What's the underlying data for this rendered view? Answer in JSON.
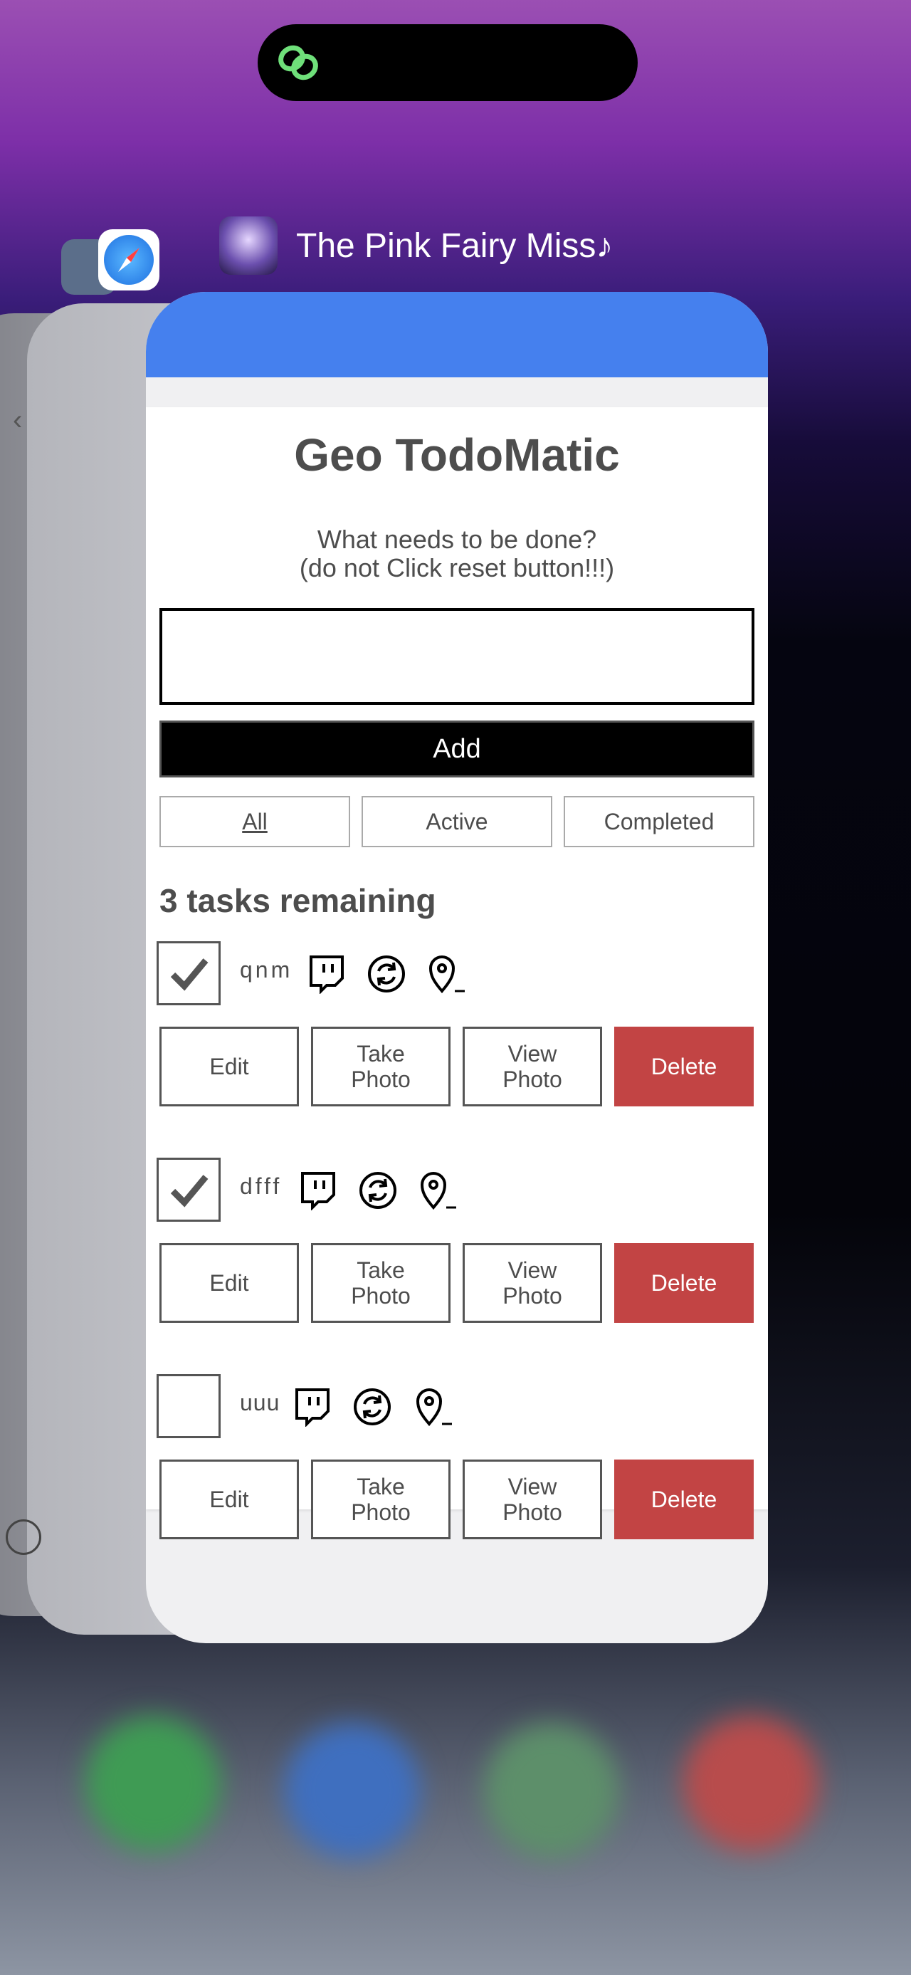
{
  "app_switcher": {
    "current_app_title": "The Pink Fairy Miss♪"
  },
  "todo_app": {
    "heading": "Geo TodoMatic",
    "instruction_line1": "What needs to be done?",
    "instruction_line2": "(do not Click reset button!!!)",
    "new_task_value": "",
    "add_label": "Add",
    "filters": [
      "All",
      "Active",
      "Completed"
    ],
    "selected_filter": "All",
    "remaining_text": "3 tasks remaining",
    "todos": [
      {
        "name": "qnm",
        "completed": true,
        "buttons": [
          "Edit",
          "Take\nPhoto",
          "View\nPhoto",
          "Delete"
        ]
      },
      {
        "name": "dfff",
        "completed": true,
        "buttons": [
          "Edit",
          "Take\nPhoto",
          "View\nPhoto",
          "Delete"
        ]
      },
      {
        "name": "uuu",
        "completed": false,
        "buttons": [
          "Edit",
          "Take\nPhoto",
          "View\nPhoto",
          "Delete"
        ]
      }
    ],
    "icons": [
      "chat-icon",
      "refresh-icon",
      "location-pin-icon"
    ]
  },
  "colors": {
    "header_blue": "#4580ee",
    "delete_red": "#c24444",
    "text_gray": "#4d4d4d"
  }
}
